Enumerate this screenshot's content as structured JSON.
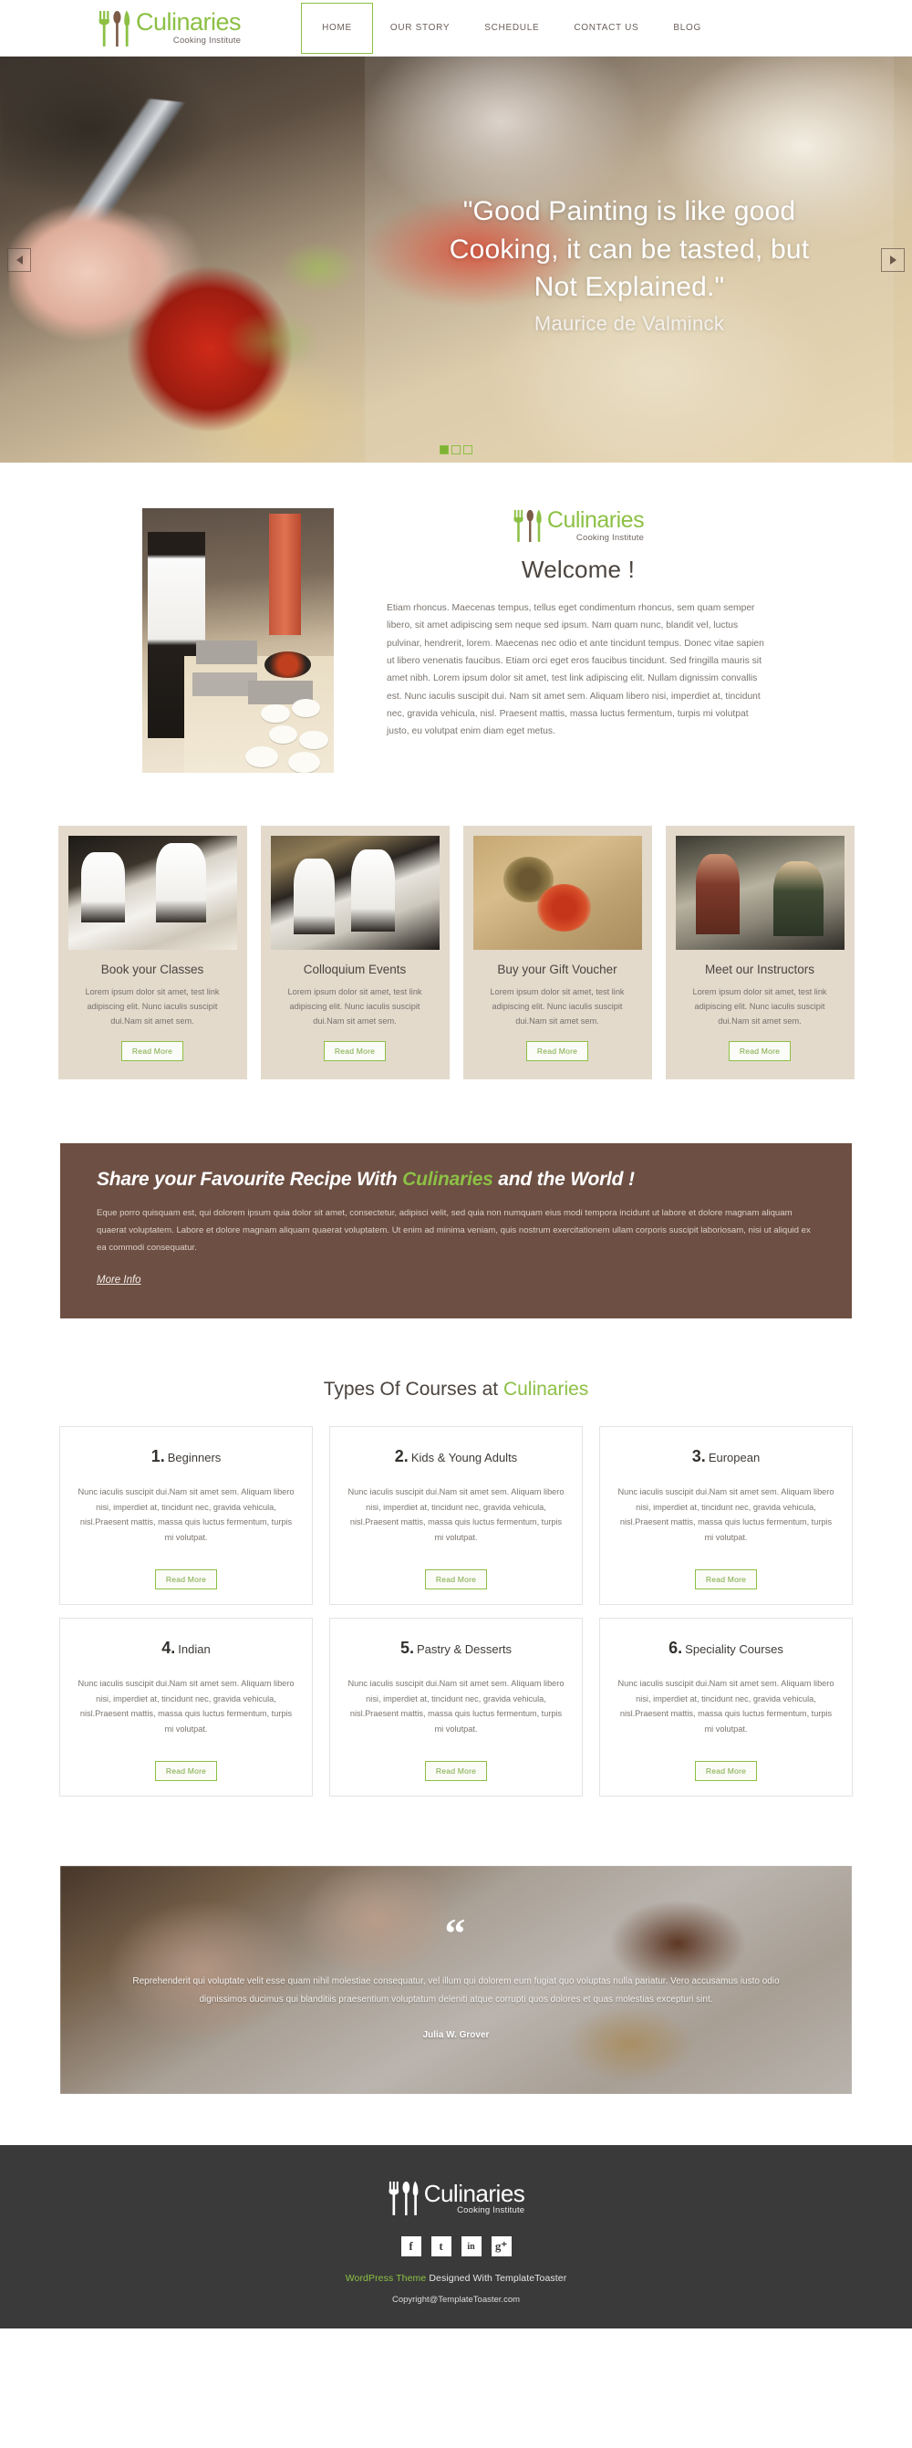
{
  "brand": {
    "name": "Culinaries",
    "tagline": "Cooking Institute",
    "accent_green": "#8cc045",
    "brown": "#6d4f43"
  },
  "nav": {
    "items": [
      {
        "label": "HOME",
        "active": true
      },
      {
        "label": "OUR STORY",
        "active": false
      },
      {
        "label": "SCHEDULE",
        "active": false
      },
      {
        "label": "CONTACT US",
        "active": false
      },
      {
        "label": "BLOG",
        "active": false
      }
    ]
  },
  "hero": {
    "quote": "\"Good Painting is like good Cooking, it can be tasted, but Not Explained.\"",
    "author": "Maurice de Valminck",
    "prev_icon": "arrow-left-icon",
    "next_icon": "arrow-right-icon",
    "dots": 3,
    "active_dot": 1
  },
  "welcome": {
    "title": "Welcome !",
    "body": "Etiam rhoncus. Maecenas tempus, tellus eget condimentum rhoncus, sem quam semper libero, sit amet adipiscing sem neque sed ipsum. Nam quam nunc, blandit vel, luctus pulvinar, hendrerit, lorem. Maecenas nec odio et ante tincidunt tempus. Donec vitae sapien ut libero venenatis faucibus. Etiam orci eget eros faucibus tincidunt. Sed fringilla mauris sit amet nibh. Lorem ipsum dolor sit amet, test link adipiscing elit. Nullam dignissim convallis est. Nunc iaculis suscipit dui. Nam sit amet sem. Aliquam libero nisi, imperdiet at, tincidunt nec, gravida vehicula, nisl. Praesent mattis, massa luctus fermentum, turpis mi volutpat justo, eu volutpat enim diam eget metus."
  },
  "services": {
    "read_more_label": "Read More",
    "cards": [
      {
        "title": "Book your Classes",
        "desc": "Lorem ipsum dolor sit amet, test link adipiscing elit. Nunc iaculis suscipit dui.Nam sit amet sem."
      },
      {
        "title": "Colloquium Events",
        "desc": "Lorem ipsum dolor sit amet, test link adipiscing elit. Nunc iaculis suscipit dui.Nam sit amet sem."
      },
      {
        "title": "Buy your Gift Voucher",
        "desc": "Lorem ipsum dolor sit amet, test link adipiscing elit. Nunc iaculis suscipit dui.Nam sit amet sem."
      },
      {
        "title": "Meet our Instructors",
        "desc": "Lorem ipsum dolor sit amet, test link adipiscing elit. Nunc iaculis suscipit dui.Nam sit amet sem."
      }
    ]
  },
  "recipe_banner": {
    "title_pre": "Share your Favourite Recipe With ",
    "title_hl": "Culinaries",
    "title_post": " and the World !",
    "body": "Eque porro quisquam est, qui dolorem ipsum quia dolor sit amet, consectetur, adipisci velit, sed quia non numquam eius modi tempora incidunt ut labore et dolore magnam aliquam quaerat voluptatem. Labore et dolore magnam aliquam quaerat voluptatem. Ut enim ad minima veniam, quis nostrum exercitationem ullam corporis suscipit laboriosam, nisi ut aliquid ex ea commodi consequatur.",
    "more_label": "More Info"
  },
  "courses": {
    "heading_pre": "Types Of Courses at ",
    "heading_hl": "Culinaries",
    "read_more_label": "Read More",
    "shared_desc": "Nunc iaculis suscipit dui.Nam sit amet sem. Aliquam libero nisi, imperdiet at, tincidunt nec, gravida vehicula, nisl.Praesent mattis, massa quis luctus fermentum, turpis mi volutpat.",
    "items": [
      {
        "num": "1.",
        "title": "Beginners"
      },
      {
        "num": "2.",
        "title": "Kids & Young Adults"
      },
      {
        "num": "3.",
        "title": "European"
      },
      {
        "num": "4.",
        "title": "Indian"
      },
      {
        "num": "5.",
        "title": "Pastry & Desserts"
      },
      {
        "num": "6.",
        "title": "Speciality Courses"
      }
    ]
  },
  "testimonial": {
    "quote_mark": "“",
    "text": "Reprehenderit qui voluptate velit esse quam nihil molestiae consequatur, vel illum qui dolorem eum fugiat quo voluptas nulla pariatur. Vero accusamus iusto odio dignissimos ducimus qui blanditiis praesentium voluptatum deleniti atque corrupti quos dolores et quas molestias excepturi sint.",
    "author": "Julia W. Grover"
  },
  "footer": {
    "social": [
      {
        "name": "facebook-icon",
        "glyph": "f"
      },
      {
        "name": "twitter-icon",
        "glyph": "t"
      },
      {
        "name": "linkedin-icon",
        "glyph": "in"
      },
      {
        "name": "googleplus-icon",
        "glyph": "g⁺"
      }
    ],
    "credit_hl": "WordPress Theme",
    "credit_rest": " Designed With TemplateToaster",
    "copyright": "Copyright@TemplateToaster.com"
  }
}
